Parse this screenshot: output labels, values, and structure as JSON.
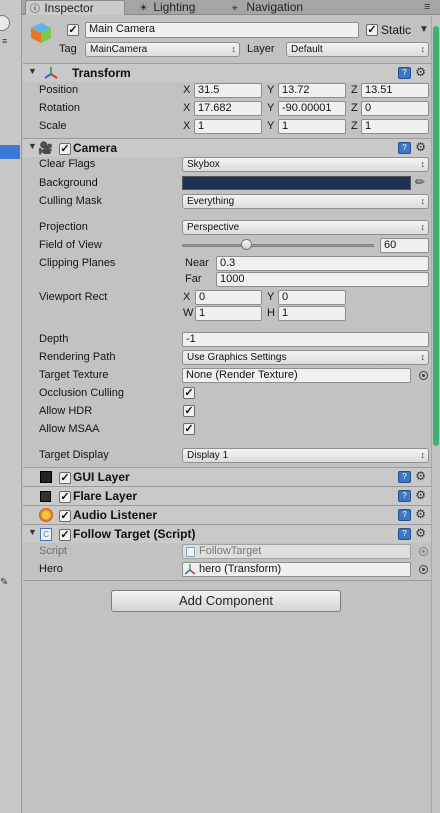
{
  "tabs": [
    {
      "label": "Inspector",
      "icon": "info-icon"
    },
    {
      "label": "Lighting",
      "icon": "lightbulb-icon"
    },
    {
      "label": "Navigation",
      "icon": "navigation-icon"
    }
  ],
  "object": {
    "name": "Main Camera",
    "static_label": "Static",
    "active": true,
    "static": true
  },
  "tag": {
    "label": "Tag",
    "value": "MainCamera"
  },
  "layer": {
    "label": "Layer",
    "value": "Default"
  },
  "transform": {
    "title": "Transform",
    "position": {
      "label": "Position",
      "x": "31.5",
      "y": "13.72",
      "z": "13.51"
    },
    "rotation": {
      "label": "Rotation",
      "x": "17.682",
      "y": "-90.00001",
      "z": "0"
    },
    "scale": {
      "label": "Scale",
      "x": "1",
      "y": "1",
      "z": "1"
    },
    "axes": {
      "x": "X",
      "y": "Y",
      "z": "Z"
    }
  },
  "camera": {
    "title": "Camera",
    "clear_flags": {
      "label": "Clear Flags",
      "value": "Skybox"
    },
    "background": {
      "label": "Background",
      "color": "#1f3153"
    },
    "culling_mask": {
      "label": "Culling Mask",
      "value": "Everything"
    },
    "projection": {
      "label": "Projection",
      "value": "Perspective"
    },
    "fov": {
      "label": "Field of View",
      "value": "60",
      "fraction": 0.34
    },
    "clipping": {
      "label": "Clipping Planes",
      "near_label": "Near",
      "near": "0.3",
      "far_label": "Far",
      "far": "1000"
    },
    "viewport": {
      "label": "Viewport Rect",
      "x_label": "X",
      "x": "0",
      "y_label": "Y",
      "y": "0",
      "w_label": "W",
      "w": "1",
      "h_label": "H",
      "h": "1"
    },
    "depth": {
      "label": "Depth",
      "value": "-1"
    },
    "rendering_path": {
      "label": "Rendering Path",
      "value": "Use Graphics Settings"
    },
    "target_texture": {
      "label": "Target Texture",
      "value": "None (Render Texture)"
    },
    "occlusion": {
      "label": "Occlusion Culling",
      "checked": true
    },
    "hdr": {
      "label": "Allow HDR",
      "checked": true
    },
    "msaa": {
      "label": "Allow MSAA",
      "checked": true
    },
    "target_display": {
      "label": "Target Display",
      "value": "Display 1"
    }
  },
  "components": [
    {
      "title": "GUI Layer"
    },
    {
      "title": "Flare Layer"
    },
    {
      "title": "Audio Listener"
    }
  ],
  "follow": {
    "title": "Follow Target (Script)",
    "script": {
      "label": "Script",
      "value": "FollowTarget"
    },
    "hero": {
      "label": "Hero",
      "value": "hero (Transform)"
    }
  },
  "add_component": "Add Component",
  "colors": {
    "accent": "#3d77c2",
    "scrollbar": "#3cb371",
    "selection": "#3b78d8"
  }
}
